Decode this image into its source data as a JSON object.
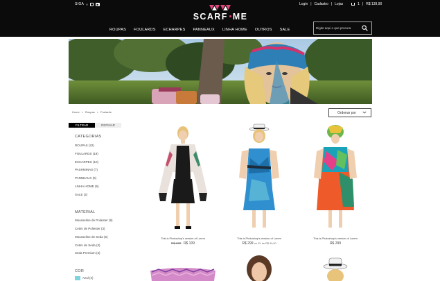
{
  "header": {
    "siga": "SIGA",
    "social": {
      "facebook": "f",
      "youtube": "▶"
    },
    "brand": {
      "left": "SCARF",
      "right": "ME"
    },
    "account": {
      "login": "Login",
      "cadastro": "Cadastro",
      "lojas": "Lojas",
      "cart_count": "1",
      "cart_total": "R$ 139,90"
    },
    "nav": [
      "ROUPAS",
      "FOULARDS",
      "ECHARPES",
      "PANNEAUX",
      "LINHA HOME",
      "OUTROS",
      "SALE"
    ],
    "search": {
      "placeholder": "Digite aqui o que procura"
    }
  },
  "breadcrumb": [
    "Home",
    ">",
    "Roupas",
    ">",
    "Foulards"
  ],
  "sort": {
    "label": "Ordenar por"
  },
  "filter_tabs": {
    "filtrar": "FILTRAR",
    "refinar": "REFINAR"
  },
  "sidebar": {
    "categorias": {
      "title": "CATEGORIAS",
      "items": [
        "ROUPAS (22)",
        "FOULARDS (19)",
        "ECHARPES (10)",
        "PASHMINAS (7)",
        "PANNEAUX (6)",
        "LINHA HOME (5)",
        "SALE (2)"
      ]
    },
    "material": {
      "title": "MATERIAL",
      "items": [
        "Mousseline de Poliester (9)",
        "Cetim de Poliester (3)",
        "Mousseline de Seda (5)",
        "Cetim de Seda (3)",
        "Seda Premium (3)"
      ]
    },
    "cor": {
      "title": "COR",
      "items": [
        {
          "label": "Azul (4)",
          "color": "#7fd3dc"
        }
      ]
    }
  },
  "products": [
    {
      "caption": "This is Photoshop's version of Lorem",
      "old_price": "R$ 299",
      "price": "R$ 109",
      "installments": ""
    },
    {
      "caption": "This is Photoshop's version of Lorem",
      "old_price": "",
      "price": "R$ 299",
      "installments": "ou 3X de R$ 99,90"
    },
    {
      "caption": "This is Photoshop's version of Lorem",
      "old_price": "",
      "price": "R$ 299",
      "installments": ""
    }
  ]
}
